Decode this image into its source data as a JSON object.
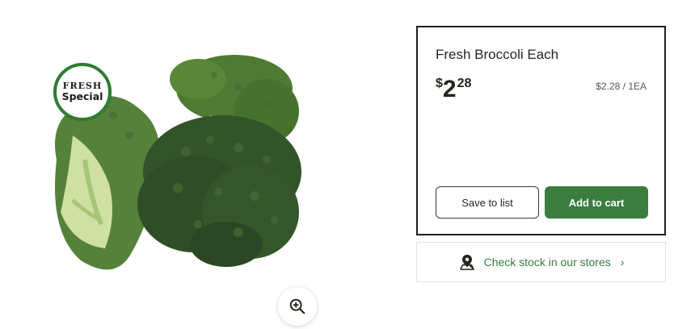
{
  "product": {
    "title": "Fresh Broccoli Each",
    "price_currency": "$",
    "price_dollars": "2",
    "price_cents": "28",
    "unit_price": "$2.28 / 1EA",
    "badge_line1": "FRESH",
    "badge_line2": "Special",
    "image_icon": "broccoli-image"
  },
  "actions": {
    "save_label": "Save to list",
    "add_label": "Add to cart"
  },
  "stock": {
    "label": "Check stock in our stores",
    "icon": "map-pin-icon",
    "chevron": "›"
  },
  "zoom": {
    "icon": "zoom-in-icon"
  },
  "colors": {
    "accent_green": "#3a7d3f",
    "badge_ring": "#2e7d32",
    "card_border": "#1f1f1f"
  }
}
